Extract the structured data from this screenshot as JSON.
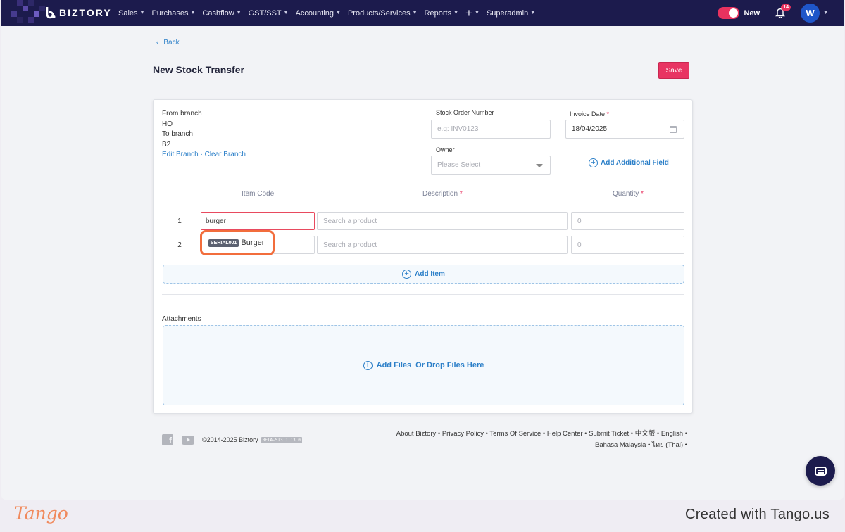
{
  "nav": {
    "brand": "BIZTORY",
    "menu": [
      {
        "label": "Sales"
      },
      {
        "label": "Purchases"
      },
      {
        "label": "Cashflow"
      },
      {
        "label": "GST/SST"
      },
      {
        "label": "Accounting"
      },
      {
        "label": "Products/Services"
      },
      {
        "label": "Reports"
      },
      {
        "label": "+"
      },
      {
        "label": "Superadmin"
      }
    ],
    "toggle_label": "New",
    "notification_count": "14",
    "avatar_initial": "W",
    "colors": {
      "bar": "#1c1b4d",
      "accent": "#e8325f",
      "avatar": "#1f56c9"
    }
  },
  "page": {
    "back_label": "Back",
    "title": "New Stock Transfer",
    "save_label": "Save"
  },
  "form": {
    "from_branch_label": "From branch",
    "from_branch_value": "HQ",
    "to_branch_label": "To branch",
    "to_branch_value": "B2",
    "edit_branch": "Edit Branch",
    "separator": "·",
    "clear_branch": "Clear Branch",
    "stock_order_label": "Stock Order Number",
    "stock_order_placeholder": "e.g: INV0123",
    "invoice_date_label": "Invoice Date",
    "required_mark": "*",
    "invoice_date_value": "18/04/2025",
    "owner_label": "Owner",
    "owner_placeholder": "Please Select",
    "add_additional_field": "Add Additional Field"
  },
  "items": {
    "columns": {
      "item_code": "Item Code",
      "description": "Description",
      "quantity": "Quantity"
    },
    "rows": [
      {
        "num": "1",
        "item_code": "burger",
        "description_placeholder": "Search a product",
        "quantity_placeholder": "0"
      },
      {
        "num": "2",
        "item_code": "",
        "description_placeholder": "Search a product",
        "quantity_placeholder": "0"
      }
    ],
    "suggestion": {
      "serial": "SERIAL001",
      "name": "Burger"
    },
    "add_item": "Add Item"
  },
  "attachments": {
    "label": "Attachments",
    "add_files": "Add Files",
    "drop_files": "Or Drop Files Here"
  },
  "footer": {
    "copyright": "©2014-2025 Biztory",
    "version": "BETA-SI3 1.13.0",
    "links_line1": "About Biztory • Privacy Policy • Terms Of Service • Help Center • Submit Ticket • 中文版 • English •",
    "links_line2": "Bahasa Malaysia • ไทย (Thai) •"
  },
  "tango": {
    "logo": "Tango",
    "credit": "Created with Tango.us"
  }
}
